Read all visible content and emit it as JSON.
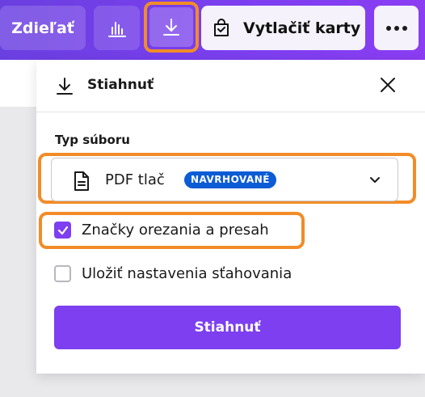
{
  "toolbar": {
    "share_label": "Zdieľať",
    "stats_icon": "bar-chart-icon",
    "download_icon": "download-icon",
    "print_label": "Vytlačiť karty",
    "print_icon": "print-bag-icon",
    "more_icon": "more-horizontal-icon"
  },
  "panel": {
    "title": "Stiahnuť",
    "title_icon": "download-icon",
    "close_icon": "close-icon",
    "file_type_label": "Typ súboru",
    "file_type_value": "PDF tlač",
    "file_type_badge": "NAVRHOVANÉ",
    "checkboxes": [
      {
        "label": "Značky orezania a presah",
        "checked": true
      },
      {
        "label": "Uložiť nastavenia sťahovania",
        "checked": false
      }
    ],
    "download_button_label": "Stiahnuť"
  },
  "colors": {
    "brand": "#7d3ff0",
    "highlight": "#f28c28",
    "badge": "#0b5cd5"
  }
}
